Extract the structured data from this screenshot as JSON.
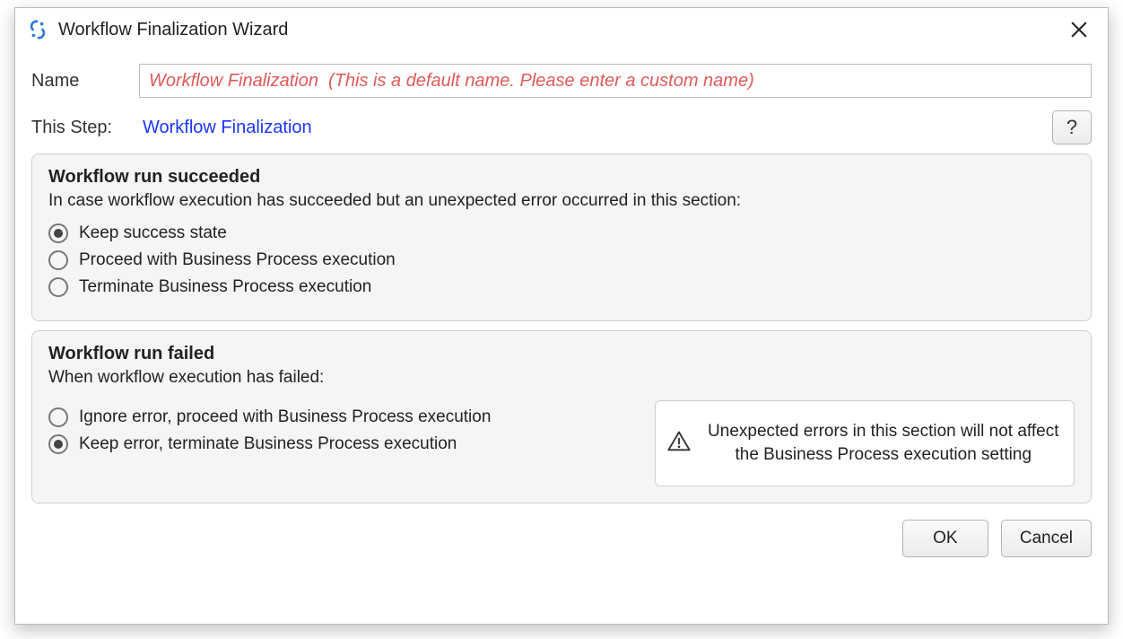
{
  "window": {
    "title": "Workflow Finalization Wizard"
  },
  "form": {
    "name_label": "Name",
    "name_value": "Workflow Finalization  (This is a default name. Please enter a custom name)",
    "step_label": "This Step:",
    "step_value": "Workflow Finalization"
  },
  "succeeded": {
    "title": "Workflow run succeeded",
    "desc": "In case workflow execution has succeeded but an unexpected error occurred in this section:",
    "options": [
      {
        "label": "Keep success state",
        "checked": true
      },
      {
        "label": "Proceed with Business Process execution",
        "checked": false
      },
      {
        "label": "Terminate Business Process execution",
        "checked": false
      }
    ]
  },
  "failed": {
    "title": "Workflow run failed",
    "desc": "When workflow execution has failed:",
    "options": [
      {
        "label": "Ignore error, proceed with Business Process execution",
        "checked": false
      },
      {
        "label": "Keep error, terminate Business Process execution",
        "checked": true
      }
    ],
    "info": "Unexpected errors in this section will not affect the Business Process execution setting"
  },
  "buttons": {
    "ok": "OK",
    "cancel": "Cancel"
  },
  "icons": {
    "app": "wizard-icon",
    "close": "close-icon",
    "help": "?",
    "warn": "warning-icon"
  },
  "colors": {
    "link": "#1a36ff",
    "placeholder": "#e25a5a"
  }
}
